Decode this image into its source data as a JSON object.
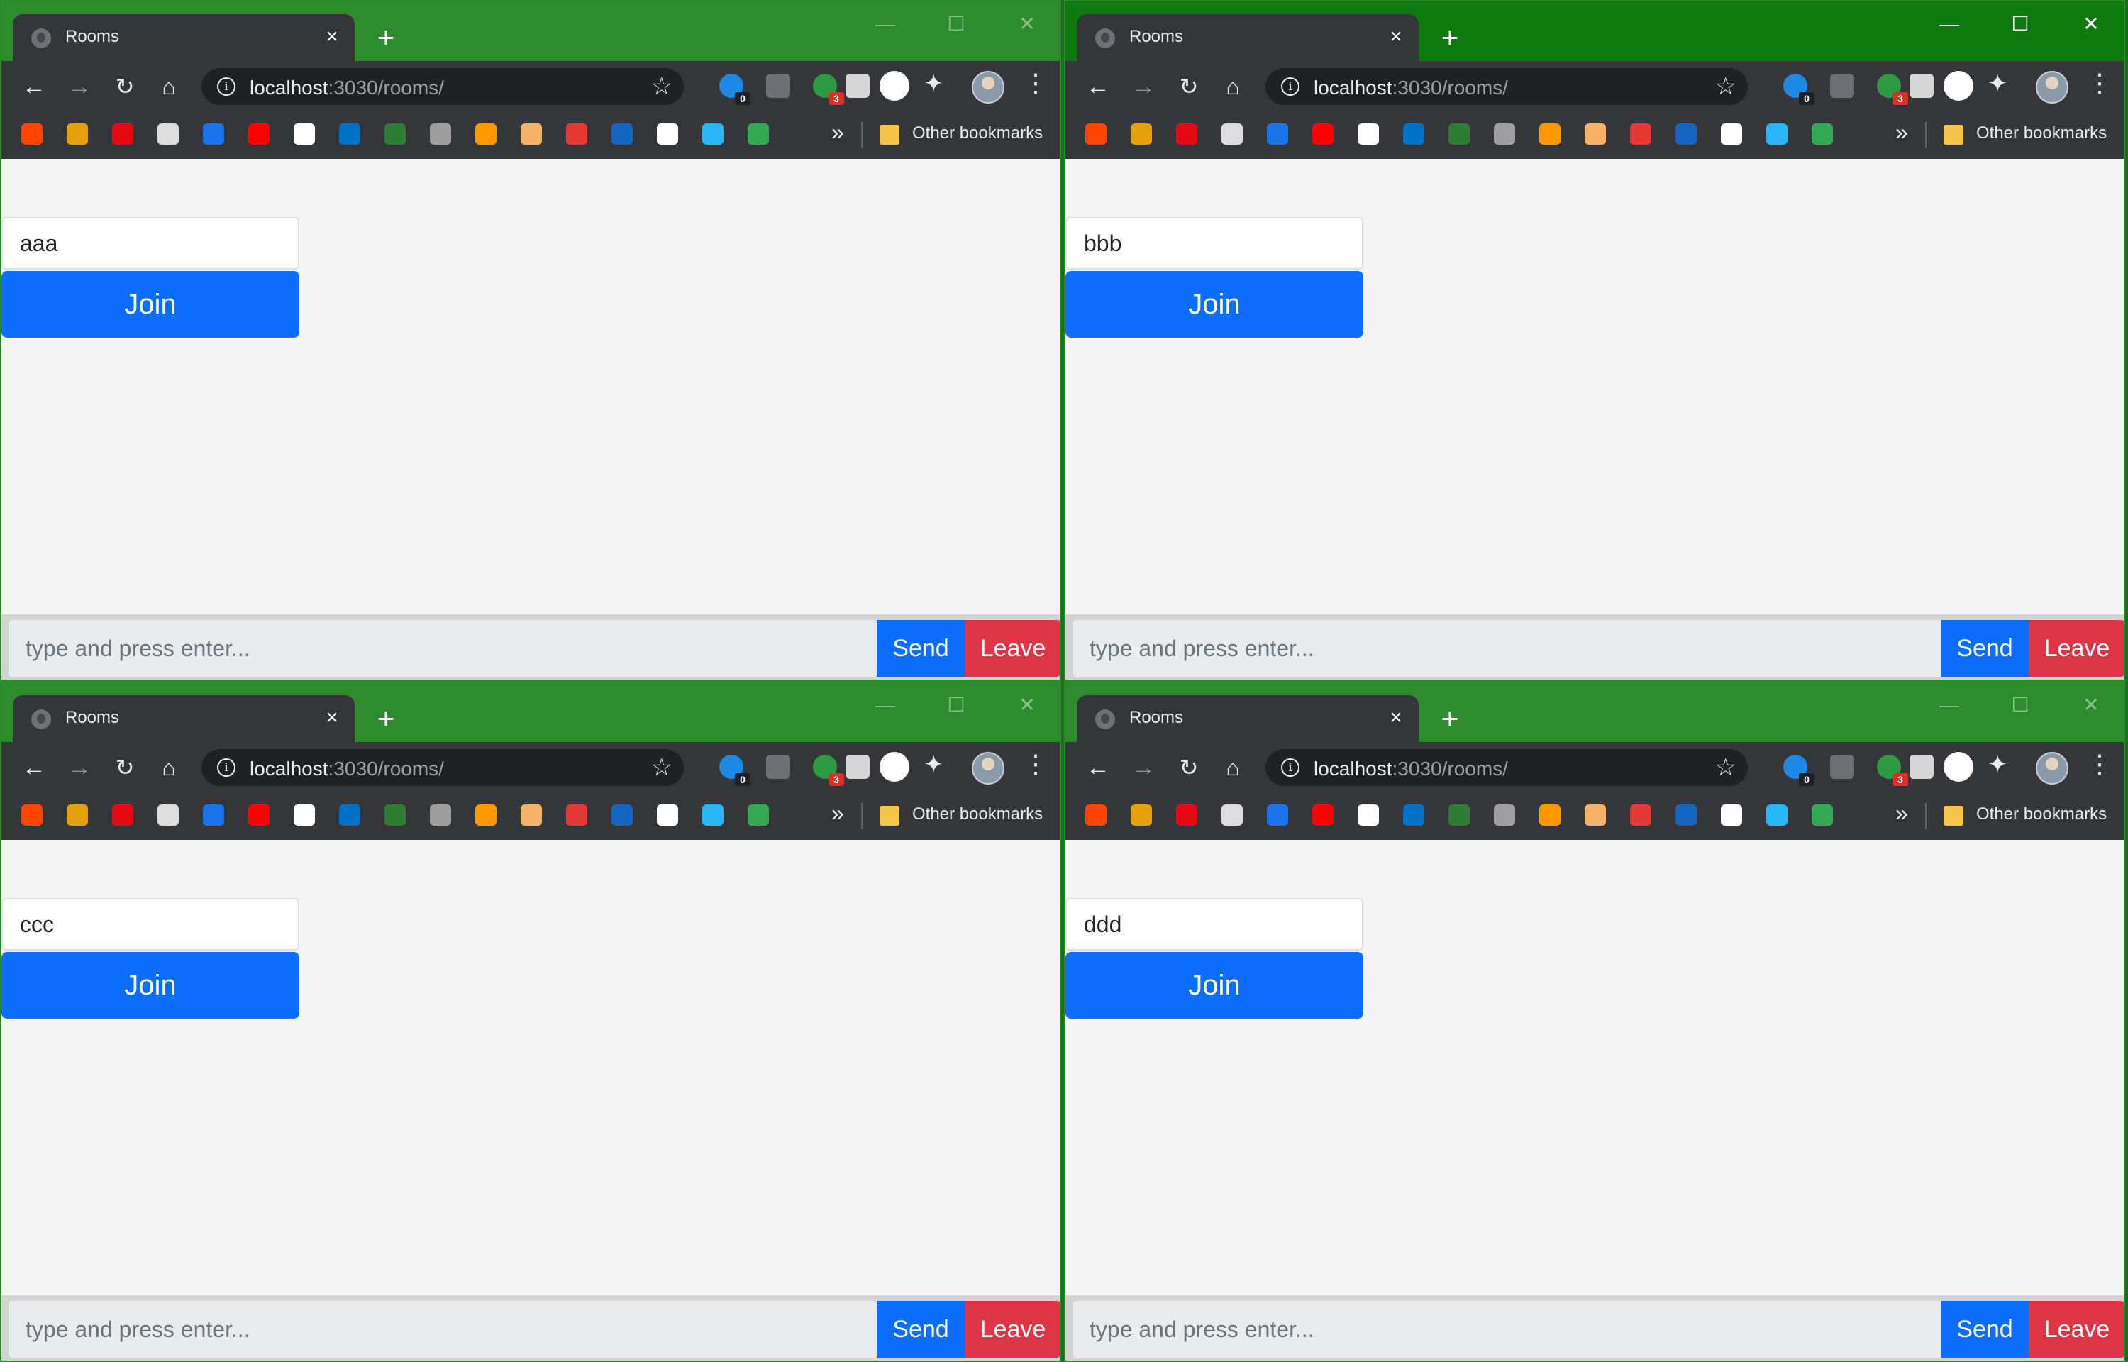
{
  "browser": {
    "tab_title": "Rooms",
    "tab_close_glyph": "×",
    "new_tab_glyph": "+",
    "window_controls": {
      "minimize": "—",
      "maximize": "☐",
      "close": "✕"
    },
    "url_host": "localhost",
    "url_path": ":3030/rooms/",
    "extension_badges": {
      "first": "0",
      "second": "3"
    },
    "bookmarks_overflow": "»",
    "other_bookmarks_label": "Other bookmarks",
    "icons": [
      "back-icon",
      "forward-icon",
      "reload-icon",
      "home-icon",
      "info-icon",
      "star-icon",
      "extensions-icon",
      "menu-icon"
    ],
    "bookmark_colors": [
      "#ff4500",
      "#e5a00d",
      "#e50914",
      "#dddddd",
      "#1a73e8",
      "#ff0000",
      "#ffffff",
      "#0072c6",
      "#2e7d32",
      "#9e9e9e",
      "#ff9800",
      "#f6b26b",
      "#e53935",
      "#1565c0",
      "#ffffff",
      "#29b6f6",
      "#34a853"
    ]
  },
  "windows": [
    {
      "room_value": "aaa",
      "active": false
    },
    {
      "room_value": "bbb",
      "active": true
    },
    {
      "room_value": "ccc",
      "active": false
    },
    {
      "room_value": "ddd",
      "active": false
    }
  ],
  "page": {
    "join_label": "Join",
    "message_placeholder": "type and press enter...",
    "send_label": "Send",
    "leave_label": "Leave"
  },
  "colors": {
    "primary": "#0d6efd",
    "danger": "#dc3545",
    "titlebar": "#2e8b2e",
    "titlebar_active": "#0f7a0f",
    "chrome_dark": "#35363a"
  }
}
